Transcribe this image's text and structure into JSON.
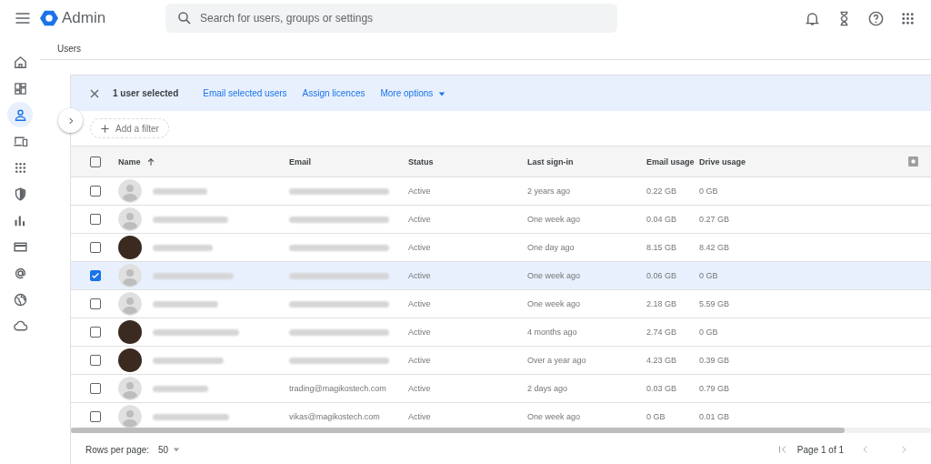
{
  "app": {
    "title": "Admin"
  },
  "search": {
    "placeholder": "Search for users, groups or settings"
  },
  "nav": [
    {
      "kind": "home",
      "selected": false
    },
    {
      "kind": "dashboard",
      "selected": false
    },
    {
      "kind": "users",
      "selected": true
    },
    {
      "kind": "devices",
      "selected": false
    },
    {
      "kind": "apps",
      "selected": false
    },
    {
      "kind": "security",
      "selected": false
    },
    {
      "kind": "reports",
      "selected": false
    },
    {
      "kind": "billing",
      "selected": false
    },
    {
      "kind": "account",
      "selected": false
    },
    {
      "kind": "rules",
      "selected": false
    },
    {
      "kind": "storage",
      "selected": false
    }
  ],
  "breadcrumb": "Users",
  "selection_bar": {
    "count_label": "1 user selected",
    "actions": [
      "Email selected users",
      "Assign licences",
      "More options"
    ]
  },
  "filter": {
    "label": "Add a filter"
  },
  "table": {
    "all_selected": false,
    "columns": [
      {
        "label": "Name",
        "sorted": true
      },
      {
        "label": "Email",
        "sorted": false
      },
      {
        "label": "Status",
        "sorted": false
      },
      {
        "label": "Last sign-in",
        "sorted": false
      },
      {
        "label": "Email usage",
        "sorted": false
      },
      {
        "label": "Drive usage",
        "sorted": false
      }
    ],
    "rows": [
      {
        "selected": false,
        "avatar": {
          "kind": "default"
        },
        "status": "Active",
        "last_sign_in": "2 years ago",
        "email_usage": "0.22 GB",
        "drive_usage": "0 GB"
      },
      {
        "selected": false,
        "avatar": {
          "kind": "default"
        },
        "status": "Active",
        "last_sign_in": "One week ago",
        "email_usage": "0.04 GB",
        "drive_usage": "0.27 GB"
      },
      {
        "selected": false,
        "avatar": {
          "kind": "photo"
        },
        "status": "Active",
        "last_sign_in": "One day ago",
        "email_usage": "8.15 GB",
        "drive_usage": "8.42 GB"
      },
      {
        "selected": true,
        "avatar": {
          "kind": "default"
        },
        "status": "Active",
        "last_sign_in": "One week ago",
        "email_usage": "0.06 GB",
        "drive_usage": "0 GB"
      },
      {
        "selected": false,
        "avatar": {
          "kind": "default"
        },
        "status": "Active",
        "last_sign_in": "One week ago",
        "email_usage": "2.18 GB",
        "drive_usage": "5.59 GB"
      },
      {
        "selected": false,
        "avatar": {
          "kind": "photo"
        },
        "status": "Active",
        "last_sign_in": "4 months ago",
        "email_usage": "2.74 GB",
        "drive_usage": "0 GB"
      },
      {
        "selected": false,
        "avatar": {
          "kind": "photo"
        },
        "status": "Active",
        "last_sign_in": "Over a year ago",
        "email_usage": "4.23 GB",
        "drive_usage": "0.39 GB"
      },
      {
        "selected": false,
        "avatar": {
          "kind": "default"
        },
        "email": "trading@magikostech.com",
        "status": "Active",
        "last_sign_in": "2 days ago",
        "email_usage": "0.03 GB",
        "drive_usage": "0.79 GB"
      },
      {
        "selected": false,
        "avatar": {
          "kind": "default"
        },
        "email": "vikas@magikostech.com",
        "status": "Active",
        "last_sign_in": "One week ago",
        "email_usage": "0 GB",
        "drive_usage": "0.01 GB"
      }
    ]
  },
  "pager": {
    "rows_per_page_label": "Rows per page:",
    "rows_per_page": "50",
    "page_label": "Page 1 of 1"
  }
}
